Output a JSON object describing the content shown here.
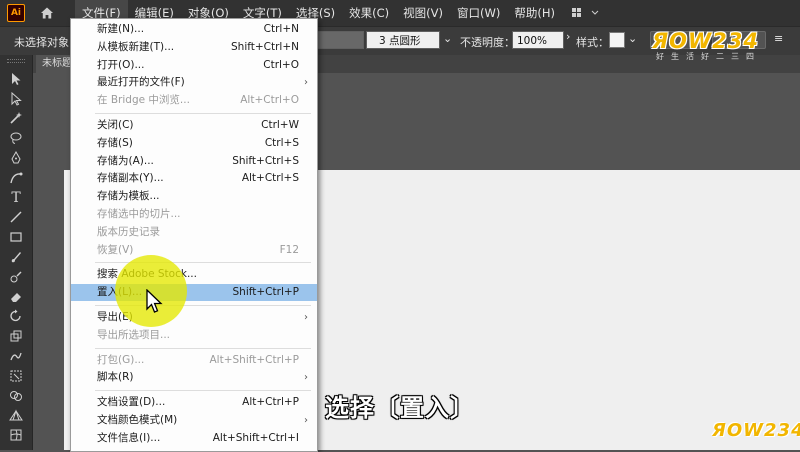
{
  "app": {
    "logo_text": "Ai"
  },
  "menubar": {
    "items": [
      {
        "label": "文件(F)",
        "active": true
      },
      {
        "label": "编辑(E)"
      },
      {
        "label": "对象(O)"
      },
      {
        "label": "文字(T)"
      },
      {
        "label": "选择(S)"
      },
      {
        "label": "效果(C)"
      },
      {
        "label": "视图(V)"
      },
      {
        "label": "窗口(W)"
      },
      {
        "label": "帮助(H)"
      }
    ]
  },
  "controlbar": {
    "selection_status": "未选择对象",
    "brush_value": "3 点圆形",
    "opacity_label": "不透明度：",
    "opacity_value": "100%",
    "style_label": "样式："
  },
  "document": {
    "tab_title": "未标题"
  },
  "file_menu": {
    "items": [
      {
        "label": "新建(N)...",
        "shortcut": "Ctrl+N"
      },
      {
        "label": "从模板新建(T)...",
        "shortcut": "Shift+Ctrl+N"
      },
      {
        "label": "打开(O)...",
        "shortcut": "Ctrl+O"
      },
      {
        "label": "最近打开的文件(F)",
        "shortcut": "",
        "submenu": true
      },
      {
        "label": "在 Bridge 中浏览...",
        "shortcut": "Alt+Ctrl+O",
        "disabled": true
      },
      {
        "separator": true
      },
      {
        "label": "关闭(C)",
        "shortcut": "Ctrl+W"
      },
      {
        "label": "存储(S)",
        "shortcut": "Ctrl+S"
      },
      {
        "label": "存储为(A)...",
        "shortcut": "Shift+Ctrl+S"
      },
      {
        "label": "存储副本(Y)...",
        "shortcut": "Alt+Ctrl+S"
      },
      {
        "label": "存储为模板...",
        "shortcut": ""
      },
      {
        "label": "存储选中的切片...",
        "shortcut": "",
        "disabled": true
      },
      {
        "label": "版本历史记录",
        "shortcut": "",
        "disabled": true
      },
      {
        "label": "恢复(V)",
        "shortcut": "F12",
        "disabled": true
      },
      {
        "separator": true
      },
      {
        "label": "搜索 Adobe Stock...",
        "shortcut": ""
      },
      {
        "label": "置入(L)...",
        "shortcut": "Shift+Ctrl+P",
        "highlighted": true
      },
      {
        "separator": true
      },
      {
        "label": "导出(E)",
        "shortcut": "",
        "submenu": true
      },
      {
        "label": "导出所选项目...",
        "shortcut": "",
        "disabled": true
      },
      {
        "separator": true
      },
      {
        "label": "打包(G)...",
        "shortcut": "Alt+Shift+Ctrl+P",
        "disabled": true
      },
      {
        "label": "脚本(R)",
        "shortcut": "",
        "submenu": true
      },
      {
        "separator": true
      },
      {
        "label": "文档设置(D)...",
        "shortcut": "Alt+Ctrl+P"
      },
      {
        "label": "文档颜色模式(M)",
        "shortcut": "",
        "submenu": true
      },
      {
        "label": "文件信息(I)...",
        "shortcut": "Alt+Shift+Ctrl+I"
      }
    ]
  },
  "caption": {
    "text": "选择〔置入〕"
  },
  "watermark": {
    "logo": "ЯOW234",
    "sub": "好生活好二三四"
  }
}
